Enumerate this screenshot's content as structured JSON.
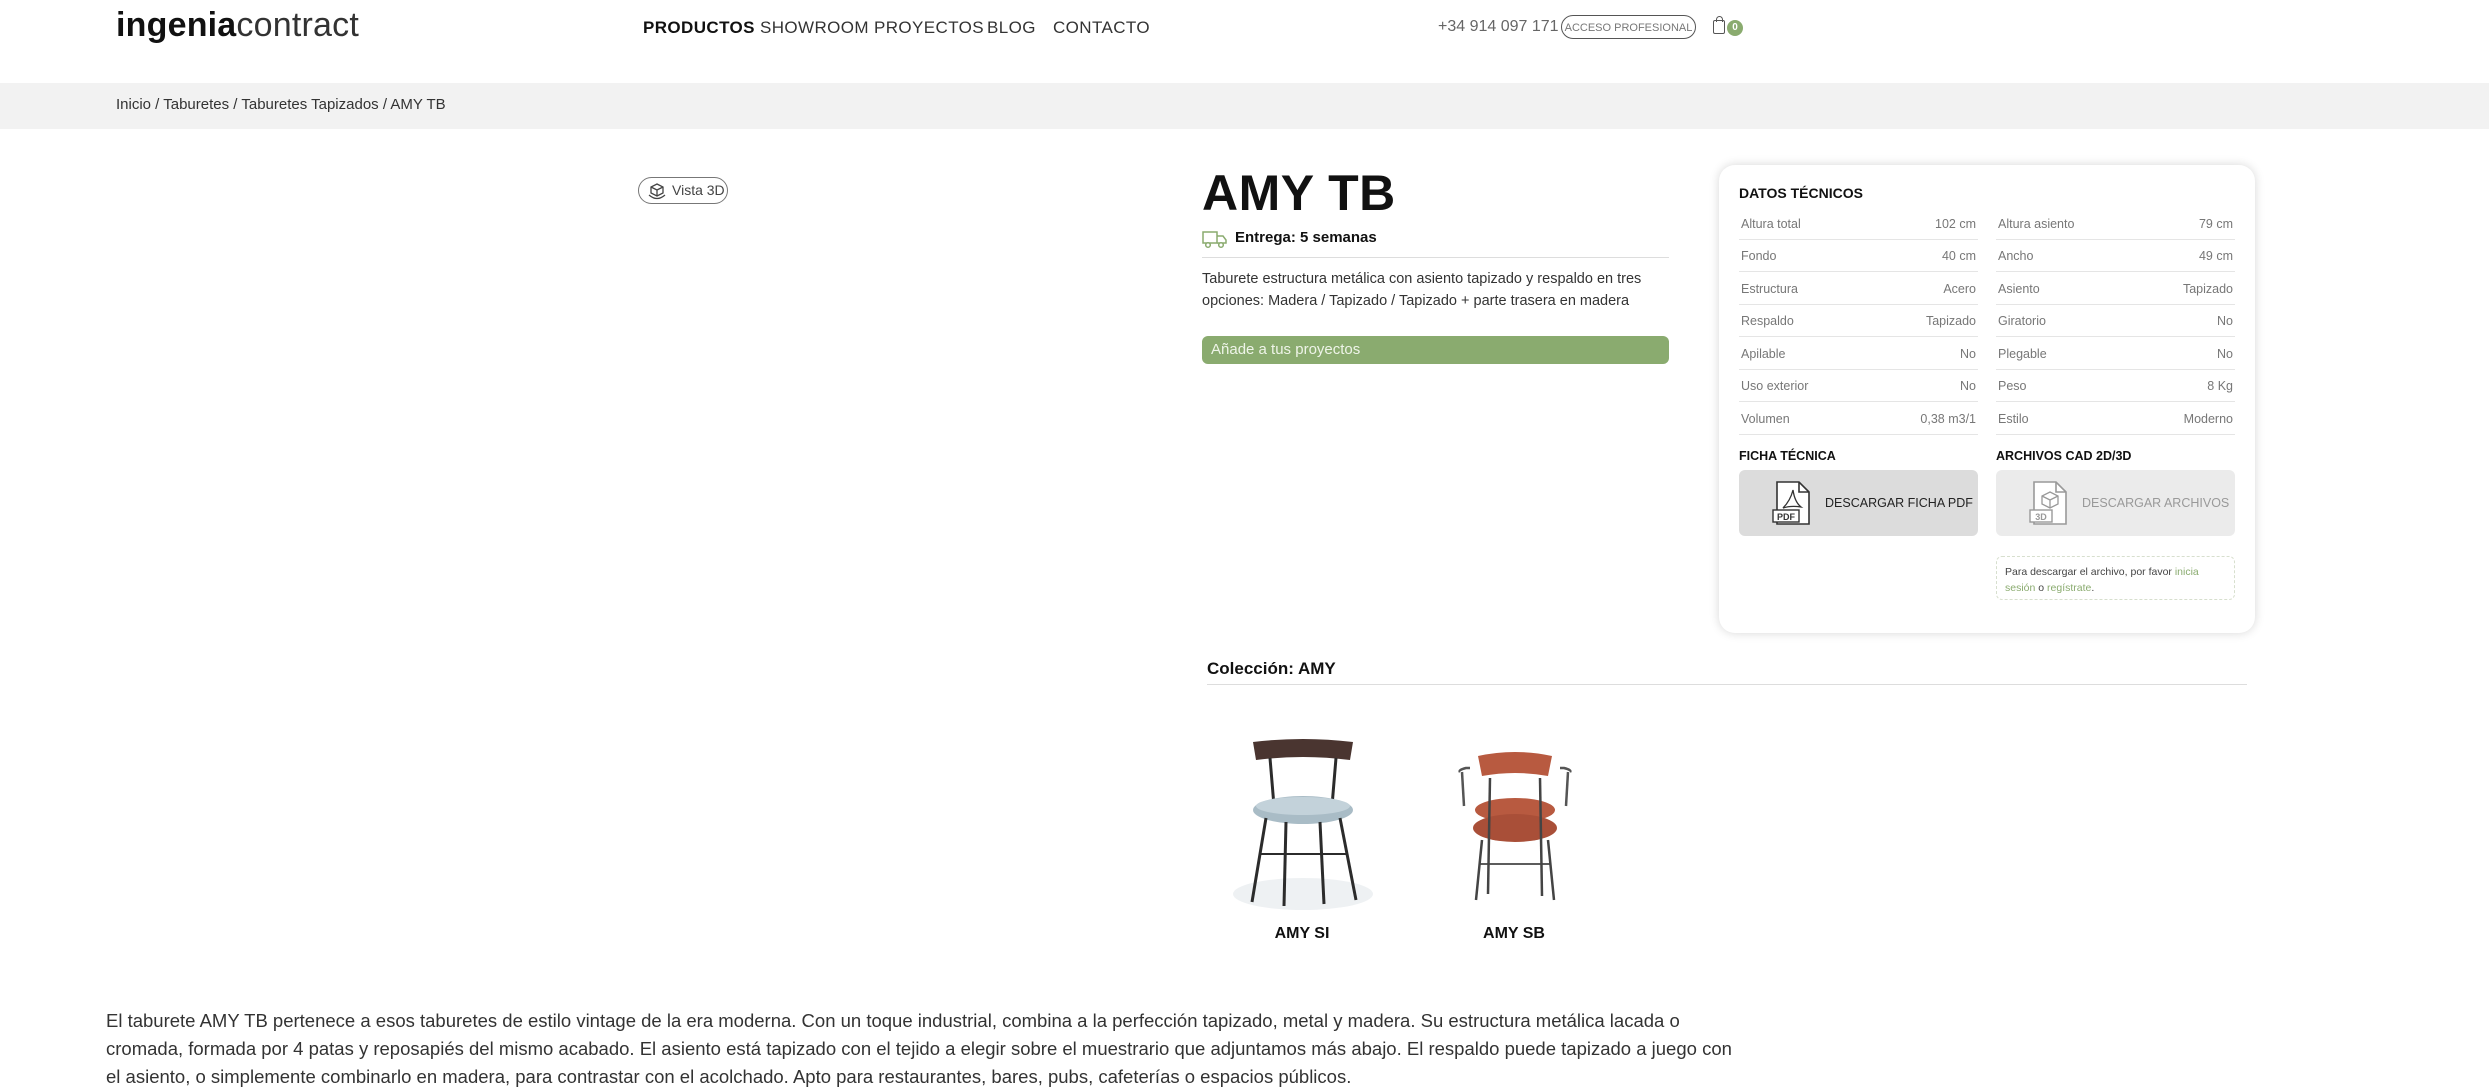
{
  "header": {
    "logo_bold": "ingenia",
    "logo_light": "contract",
    "nav": [
      "PRODUCTOS",
      "SHOWROOM",
      "PROYECTOS",
      "BLOG",
      "CONTACTO"
    ],
    "phone": "+34 914 097 171",
    "pro_button": "ACCESO PROFESIONAL",
    "cart_count": "0"
  },
  "breadcrumb": "Inicio / Taburetes / Taburetes Tapizados / AMY TB",
  "viewer": {
    "vista3d_label": "Vista 3D"
  },
  "product": {
    "title": "AMY TB",
    "delivery": "Entrega: 5 semanas",
    "description": "Taburete estructura metálica con asiento tapizado y respaldo en tres opciones: Madera / Tapizado / Tapizado + parte trasera en madera",
    "add_button": "Añade a tus proyectos"
  },
  "tech": {
    "title": "DATOS TÉCNICOS",
    "rows": [
      [
        [
          "Altura total",
          "102 cm"
        ],
        [
          "Altura asiento",
          "79 cm"
        ]
      ],
      [
        [
          "Fondo",
          "40 cm"
        ],
        [
          "Ancho",
          "49 cm"
        ]
      ],
      [
        [
          "Estructura",
          "Acero"
        ],
        [
          "Asiento",
          "Tapizado"
        ]
      ],
      [
        [
          "Respaldo",
          "Tapizado"
        ],
        [
          "Giratorio",
          "No"
        ]
      ],
      [
        [
          "Apilable",
          "No"
        ],
        [
          "Plegable",
          "No"
        ]
      ],
      [
        [
          "Uso exterior",
          "No"
        ],
        [
          "Peso",
          "8 Kg"
        ]
      ],
      [
        [
          "Volumen",
          "0,38 m3/1"
        ],
        [
          "Estilo",
          "Moderno"
        ]
      ]
    ],
    "ficha_title": "FICHA TÉCNICA",
    "ficha_button": "DESCARGAR FICHA PDF",
    "cad_title": "ARCHIVOS CAD 2D/3D",
    "cad_button": "DESCARGAR ARCHIVOS",
    "note_pre": "Para descargar el archivo, por favor ",
    "note_link1": "inicia sesión",
    "note_mid": " o ",
    "note_link2": "regístrate",
    "note_post": "."
  },
  "collection": {
    "title": "Colección: AMY",
    "items": [
      "AMY SI",
      "AMY SB"
    ]
  },
  "long_description": "El taburete AMY TB pertenece a esos taburetes de estilo vintage de la era moderna. Con un toque industrial, combina a la perfección tapizado, metal y madera. Su estructura metálica lacada o cromada, formada por 4 patas y reposapiés del mismo acabado. El asiento está tapizado con el tejido a elegir sobre el muestrario que adjuntamos más abajo. El respaldo puede tapizado a juego con el asiento, o simplemente combinarlo en madera, para contrastar con el acolchado. Apto para restaurantes, bares, pubs, cafeterías o espacios públicos.",
  "colors": {
    "accent": "#8aab6f",
    "crumb_bg": "#f2f2f2"
  }
}
